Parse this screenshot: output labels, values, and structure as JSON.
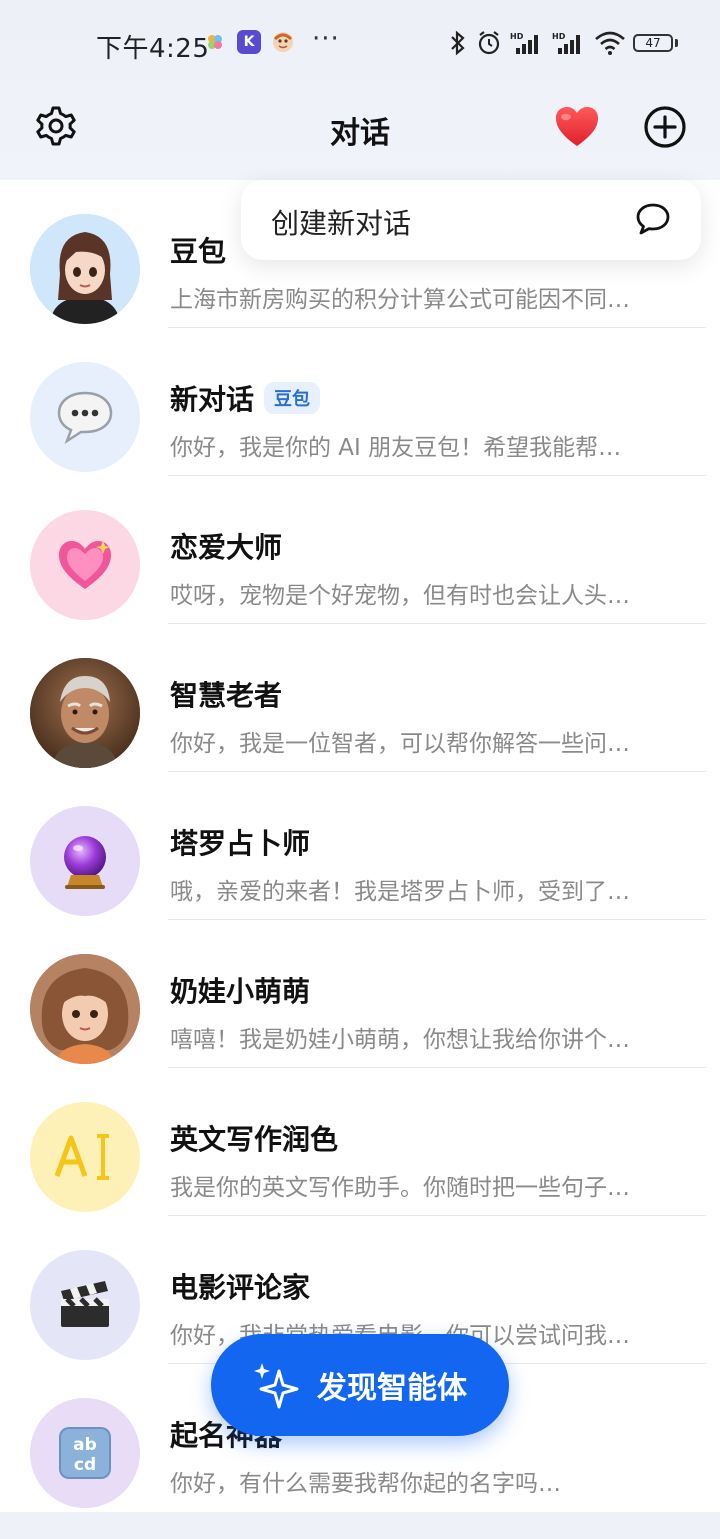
{
  "status_bar": {
    "time": "下午4:25",
    "app_icons": [
      "clover-icon",
      "k-app-icon",
      "monkey-icon"
    ],
    "more": "···",
    "network": [
      "bluetooth-icon",
      "alarm-icon",
      "signal-hd-icon",
      "signal-hd-icon",
      "wifi-icon"
    ],
    "battery": "47"
  },
  "header": {
    "title": "对话",
    "left_icon": "gear-icon",
    "heart_icon": "heart-icon",
    "add_icon": "plus-circle-icon"
  },
  "popup": {
    "label": "创建新对话",
    "icon": "chat-bubble-icon"
  },
  "conversations": [
    {
      "name": "豆包",
      "preview": "上海市新房购买的积分计算公式可能因不同…",
      "badge": "",
      "avatar": "doubao-avatar",
      "avatar_bg": "#cfe6fb"
    },
    {
      "name": "新对话",
      "preview": "你好，我是你的 AI 朋友豆包！希望我能帮…",
      "badge": "豆包",
      "avatar": "speech-bubble-icon",
      "avatar_bg": "#e6effb"
    },
    {
      "name": "恋爱大师",
      "preview": "哎呀，宠物是个好宠物，但有时也会让人头…",
      "badge": "",
      "avatar": "sparkling-heart-icon",
      "avatar_bg": "#fcd8e4"
    },
    {
      "name": "智慧老者",
      "preview": "你好，我是一位智者，可以帮你解答一些问…",
      "badge": "",
      "avatar": "old-man-avatar",
      "avatar_bg": "#6b4a32"
    },
    {
      "name": "塔罗占卜师",
      "preview": "哦，亲爱的来者！我是塔罗占卜师，受到了…",
      "badge": "",
      "avatar": "crystal-ball-icon",
      "avatar_bg": "#e6dcf7"
    },
    {
      "name": "奶娃小萌萌",
      "preview": "嘻嘻！我是奶娃小萌萌，你想让我给你讲个…",
      "badge": "",
      "avatar": "baby-avatar",
      "avatar_bg": "#a9785a"
    },
    {
      "name": "英文写作润色",
      "preview": "我是你的英文写作助手。你随时把一些句子…",
      "badge": "",
      "avatar": "ai-text-icon",
      "avatar_bg": "#fdf1b8"
    },
    {
      "name": "电影评论家",
      "preview": "你好，我非常热爱看电影。你可以尝试问我…",
      "badge": "",
      "avatar": "clapperboard-icon",
      "avatar_bg": "#e4e6f7"
    },
    {
      "name": "起名神器",
      "preview": "你好，有什么需要我帮你起的名字吗…",
      "badge": "",
      "avatar": "abcd-icon",
      "avatar_bg": "#e8dcf7"
    }
  ],
  "fab": {
    "label": "发现智能体",
    "icon": "sparkle-icon"
  }
}
